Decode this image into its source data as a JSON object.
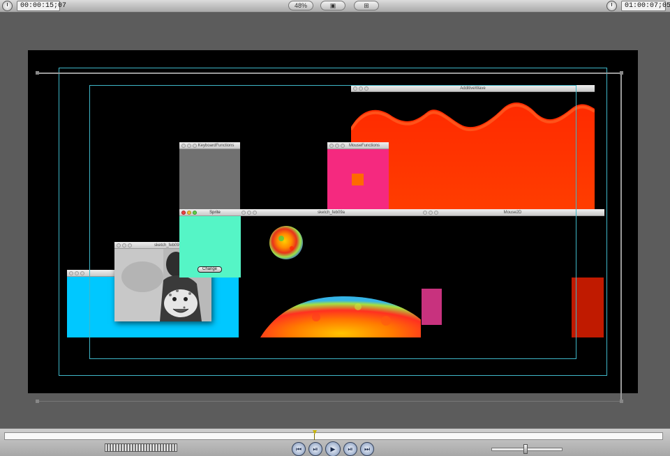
{
  "toolbar": {
    "current_timecode": "00:00:15;07",
    "zoom_label": "48%",
    "view_label": "▣",
    "overlay_label": "⊞",
    "duration_timecode": "01:00:07;05"
  },
  "windows": {
    "additive_wave": "AdditiveWave",
    "keyboard_functions": "KeyboardFunctions",
    "mouse_functions": "MouseFunctions",
    "sprite": "Sprite",
    "sketch_a": "sketch_feb09a",
    "sketch_b": "sketch_feb09b",
    "mouse2d": "Mouse2D",
    "change_button": "Change"
  },
  "transport": {
    "prev_edit": "⏮",
    "play_in_out": "⏯",
    "play": "▶",
    "play_around": "⏯",
    "next_edit": "⏭"
  },
  "colors": {
    "orange_wave": "#ff3a00",
    "magenta": "#f5297f",
    "cyan": "#00c8ff",
    "mint": "#55f5c6",
    "dark_red": "#c01a00",
    "plum": "#c8327e"
  }
}
